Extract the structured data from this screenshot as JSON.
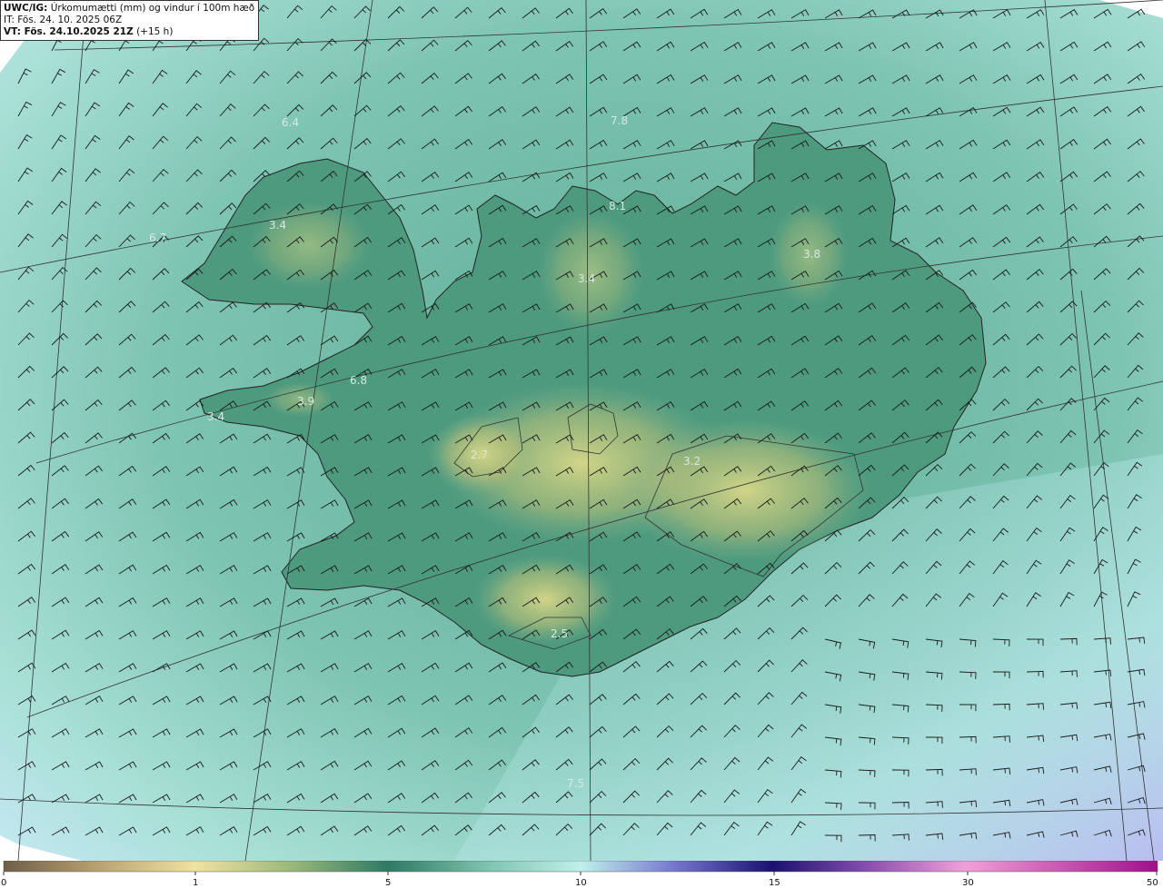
{
  "header": {
    "model_prefix": "UWC/IG:",
    "product": "Úrkomumætti (mm) og vindur í 100m hæð",
    "it_line": "IT: Fös. 24. 10. 2025 06Z",
    "vt_prefix": "VT: Fös. 24.10.2025 21Z",
    "vt_suffix": "(+15 h)"
  },
  "map_labels": [
    {
      "text": "6.4"
    },
    {
      "text": "7.8"
    },
    {
      "text": "8.1"
    },
    {
      "text": "3.4"
    },
    {
      "text": "6.7"
    },
    {
      "text": "3.4"
    },
    {
      "text": "3.8"
    },
    {
      "text": "6.8"
    },
    {
      "text": "3.9"
    },
    {
      "text": "3.4"
    },
    {
      "text": "2.7"
    },
    {
      "text": "3.2"
    },
    {
      "text": "2.5"
    },
    {
      "text": "7.5"
    }
  ],
  "colorbar": {
    "ticks": [
      "0",
      "1",
      "5",
      "10",
      "15",
      "30",
      "50"
    ],
    "stops": [
      {
        "value": 0,
        "color": "#7a6a52"
      },
      {
        "value": 1,
        "color": "#f0e2a0"
      },
      {
        "value": 5,
        "color": "#2e7a64"
      },
      {
        "value": 10,
        "color": "#bff0ea"
      },
      {
        "value": 15,
        "color": "#1a1070"
      },
      {
        "value": 30,
        "color": "#f0a0d8"
      },
      {
        "value": 50,
        "color": "#a0108a"
      }
    ]
  },
  "colors": {
    "sea": "#8fd0c2",
    "land": "#4e9a80",
    "highland": "#c9c87a",
    "outside": "#ffffff",
    "wind_barb": "#1a1a1a"
  }
}
